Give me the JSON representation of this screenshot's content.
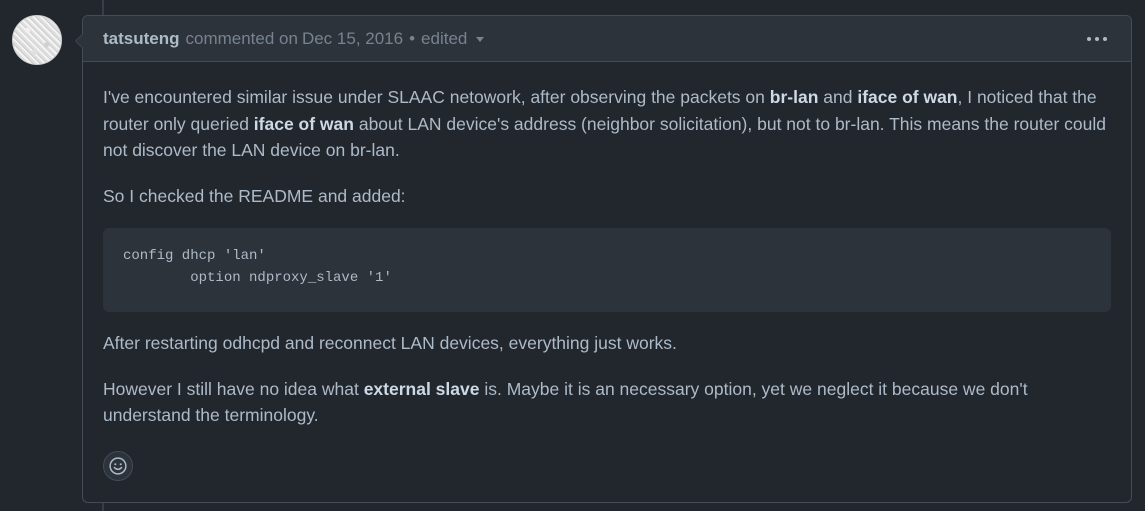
{
  "comment": {
    "author": "tatsuteng",
    "action": "commented on",
    "date": "Dec 15, 2016",
    "separator": "•",
    "edited_label": "edited",
    "more_options_icon": "kebab-horizontal-icon",
    "reaction_icon": "smiley-icon",
    "body": {
      "p1": {
        "t1": "I've encountered similar issue under SLAAC netowork, after observing the packets on ",
        "b1": "br-lan",
        "t2": " and ",
        "b2": "iface of wan",
        "t3": ", I noticed that the router only queried ",
        "b3": "iface of wan",
        "t4": " about LAN device's address (neighbor solicitation), but not to br-lan. This means the router could not discover the LAN device on br-lan."
      },
      "p2": "So I checked the README and added:",
      "code": "config dhcp 'lan'\n        option ndproxy_slave '1'",
      "p3": "After restarting odhcpd and reconnect LAN devices, everything just works.",
      "p4": {
        "t1": "However I still have no idea what ",
        "b1": "external slave",
        "t2": " is. Maybe it is an necessary option, yet we neglect it because we don't understand the terminology."
      }
    }
  },
  "colors": {
    "background": "#22272e",
    "header_background": "#2d333b",
    "border": "#444c56",
    "text": "#adbac7",
    "muted_text": "#768390"
  }
}
